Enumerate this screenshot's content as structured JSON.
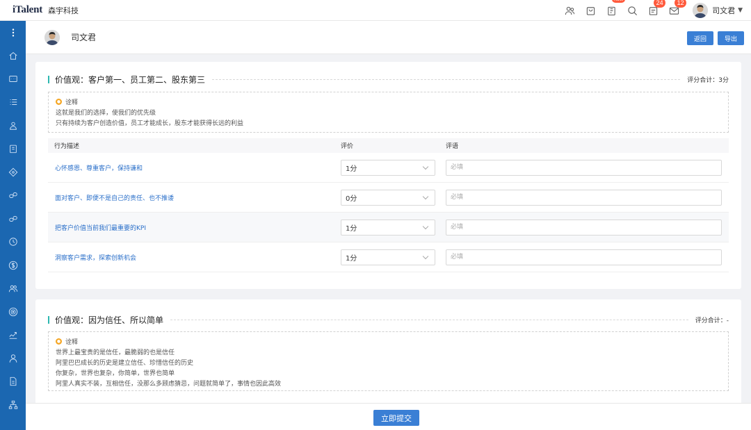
{
  "topbar": {
    "logo": "iTalent",
    "company": "森宇科技",
    "badges": {
      "new": "new",
      "notifications": "24",
      "messages": "12"
    },
    "user_name": "司文君",
    "icons": [
      "org-icon",
      "bag-icon",
      "clipboard-icon",
      "search-icon",
      "notification-icon",
      "mail-icon"
    ]
  },
  "sidebar": {
    "icons": [
      "menu-dots-icon",
      "home-icon",
      "message-icon",
      "list-icon",
      "people-icon",
      "clipboard-icon",
      "compass-icon",
      "link-icon",
      "link2-icon",
      "history-icon",
      "dollar-icon",
      "team-icon",
      "target-icon",
      "growth-icon",
      "user-icon",
      "document-icon",
      "org-chart-icon"
    ]
  },
  "header": {
    "name": "司文君",
    "back_label": "返回",
    "export_label": "导出"
  },
  "colors": {
    "primary": "#3a7fd5",
    "sidebar": "#1b67b1",
    "accent": "#2eb8b0",
    "badge": "#ff5a3c"
  },
  "sections": [
    {
      "title": "价值观：客户第一、员工第二、股东第三",
      "score": "评分合计：3分",
      "explain_label": "诠释",
      "explain_lines": [
        "这就是我们的选择，使我们的优先级",
        "只有持续为客户创造价值，员工才能成长，股东才能获得长远的利益"
      ],
      "columns": [
        "行为描述",
        "评价",
        "评语"
      ],
      "rows": [
        {
          "desc": "心怀感恩、尊重客户，保持谦和",
          "rating": "1分",
          "placeholder": "必填"
        },
        {
          "desc": "面对客户、即便不是自己的责任、也不推诿",
          "rating": "0分",
          "placeholder": "必填"
        },
        {
          "desc": "把客户价值当前我们最重要的KPI",
          "rating": "1分",
          "placeholder": "必填"
        },
        {
          "desc": "洞察客户需求，探索创新机会",
          "rating": "1分",
          "placeholder": "必填"
        }
      ]
    },
    {
      "title": "价值观：因为信任、所以简单",
      "score": "评分合计：-",
      "explain_label": "诠释",
      "explain_lines": [
        "世界上最宝贵的是信任，最脆弱的也是信任",
        "阿里巴巴成长的历史是建立信任、珍惜信任的历史",
        "你复杂，世界也复杂，你简单，世界也简单",
        "阿里人真实不装，互相信任，没那么多顾虑猜忌，问题就简单了，事情也因此高效"
      ]
    }
  ],
  "footer": {
    "submit_label": "立即提交"
  }
}
